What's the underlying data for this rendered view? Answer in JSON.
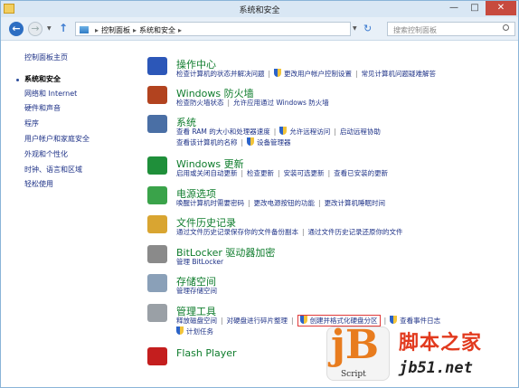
{
  "window": {
    "title": "系统和安全",
    "min": "—",
    "max": "□",
    "close": "✕"
  },
  "address": {
    "crumbs": [
      "控制面板",
      "系统和安全"
    ],
    "search_placeholder": "搜索控制面板"
  },
  "sidebar": {
    "home": "控制面板主页",
    "items": [
      "系统和安全",
      "网络和 Internet",
      "硬件和声音",
      "程序",
      "用户帐户和家庭安全",
      "外观和个性化",
      "时钟、语言和区域",
      "轻松使用"
    ]
  },
  "categories": [
    {
      "title": "操作中心",
      "icon_color": "#2c57b8",
      "links": [
        {
          "t": "检查计算机的状态并解决问题"
        },
        {
          "t": "更改用户帐户控制设置",
          "shield": true
        },
        {
          "t": "常见计算机问题疑难解答"
        }
      ],
      "links2": []
    },
    {
      "title": "Windows 防火墙",
      "icon_color": "#b2431f",
      "links": [
        {
          "t": "检查防火墙状态"
        },
        {
          "t": "允许应用通过 Windows 防火墙"
        }
      ],
      "links2": []
    },
    {
      "title": "系统",
      "icon_color": "#4a6fa5",
      "links": [
        {
          "t": "查看 RAM 的大小和处理器速度"
        },
        {
          "t": "允许远程访问",
          "shield": true
        },
        {
          "t": "启动远程协助"
        }
      ],
      "links2": [
        {
          "t": "查看该计算机的名称"
        },
        {
          "t": "设备管理器",
          "shield": true
        }
      ]
    },
    {
      "title": "Windows 更新",
      "icon_color": "#1f8f3a",
      "links": [
        {
          "t": "启用或关闭自动更新"
        },
        {
          "t": "检查更新"
        },
        {
          "t": "安装可选更新"
        },
        {
          "t": "查看已安装的更新"
        }
      ],
      "links2": []
    },
    {
      "title": "电源选项",
      "icon_color": "#3aa34a",
      "links": [
        {
          "t": "唤醒计算机时需要密码"
        },
        {
          "t": "更改电源按钮的功能"
        },
        {
          "t": "更改计算机睡眠时间"
        }
      ],
      "links2": []
    },
    {
      "title": "文件历史记录",
      "icon_color": "#d9a531",
      "links": [
        {
          "t": "通过文件历史记录保存你的文件备份副本"
        },
        {
          "t": "通过文件历史记录还原你的文件"
        }
      ],
      "links2": []
    },
    {
      "title": "BitLocker 驱动器加密",
      "icon_color": "#8a8a8a",
      "links": [
        {
          "t": "管理 BitLocker"
        }
      ],
      "links2": []
    },
    {
      "title": "存储空间",
      "icon_color": "#8aa0b8",
      "links": [
        {
          "t": "管理存储空间"
        }
      ],
      "links2": []
    },
    {
      "title": "管理工具",
      "icon_color": "#9aa0a6",
      "links": [
        {
          "t": "释放磁盘空间"
        },
        {
          "t": "对硬盘进行碎片整理"
        },
        {
          "t": "创建并格式化硬盘分区",
          "shield": true,
          "highlight": true
        },
        {
          "t": "查看事件日志",
          "shield": true
        }
      ],
      "links2": [
        {
          "t": "计划任务",
          "shield": true
        }
      ]
    },
    {
      "title": "Flash Player",
      "icon_color": "#c41e1e",
      "links": [],
      "links2": []
    }
  ],
  "watermark": {
    "logo": "jB",
    "script": "Script",
    "cn": "脚本之家",
    "url": "jb51.net"
  }
}
